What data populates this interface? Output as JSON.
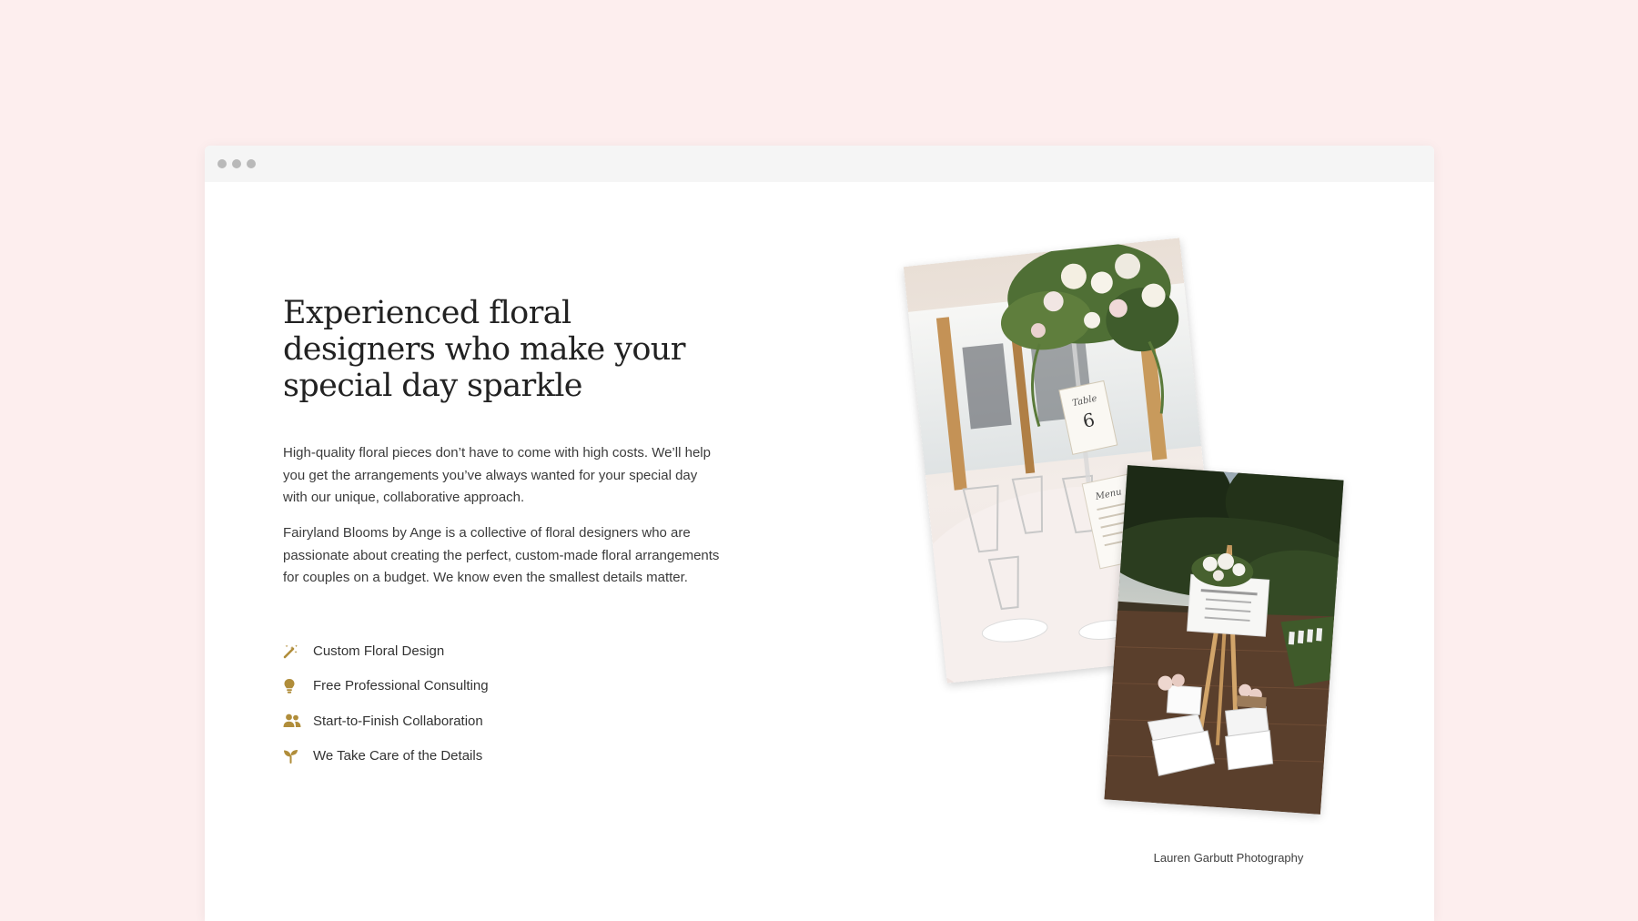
{
  "hero": {
    "heading": "Experienced floral designers who make your special day sparkle",
    "paragraph_1": "High-quality floral pieces don’t have to come with high costs. We’ll help you get the arrangements you’ve always wanted for your special day with our unique, collaborative approach.",
    "paragraph_2": "Fairyland Blooms by Ange is a collective of floral designers who are passionate about creating the perfect, custom-made floral arrangements for couples on a budget. We know even the smallest details matter."
  },
  "features": [
    {
      "label": "Custom Floral Design",
      "icon": "magic-wand-icon"
    },
    {
      "label": "Free Professional Consulting",
      "icon": "lightbulb-icon"
    },
    {
      "label": "Start-to-Finish Collaboration",
      "icon": "users-icon"
    },
    {
      "label": "We Take Care of the Details",
      "icon": "seedling-icon"
    }
  ],
  "photos": {
    "caption": "Lauren Garbutt Photography",
    "table_card": {
      "label": "Table",
      "number": "6"
    },
    "menu_card": {
      "label": "Menu"
    }
  },
  "colors": {
    "page_background": "#fdeeee",
    "accent_gold": "#b08d3a",
    "heading_text": "#222222",
    "body_text": "#3b3b3b"
  }
}
